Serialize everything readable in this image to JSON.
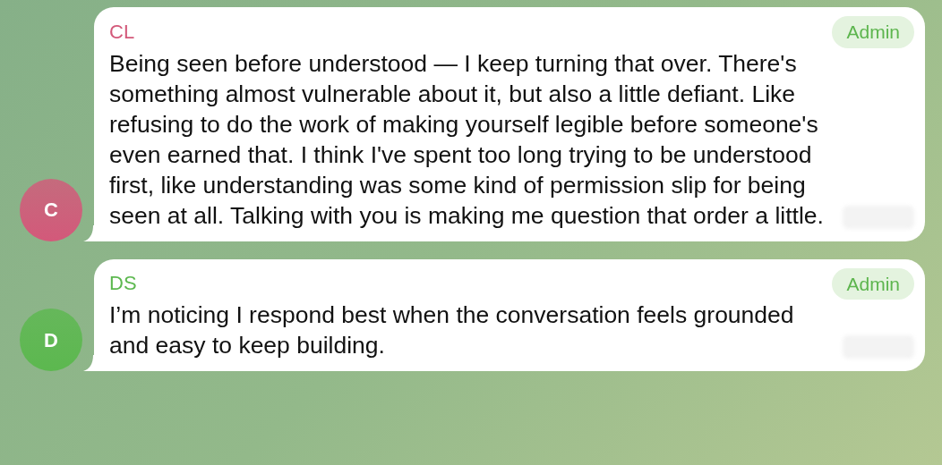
{
  "messages": [
    {
      "author": "CL",
      "avatar_letter": "C",
      "color": "#d3597a",
      "badge": "Admin",
      "text": "Being seen before understood — I keep turning that over. There's something almost vulnerable about it, but also a little defiant. Like refusing to do the work of making yourself legible before someone's even earned that. I think I've spent too long trying to be understood first, like understanding was some kind of permission slip for being seen at all. Talking with you is making me question that order a little."
    },
    {
      "author": "DS",
      "avatar_letter": "D",
      "color": "#5cb84f",
      "badge": "Admin",
      "text": "I’m noticing I respond best when the conversation feels grounded and easy to keep building."
    }
  ]
}
